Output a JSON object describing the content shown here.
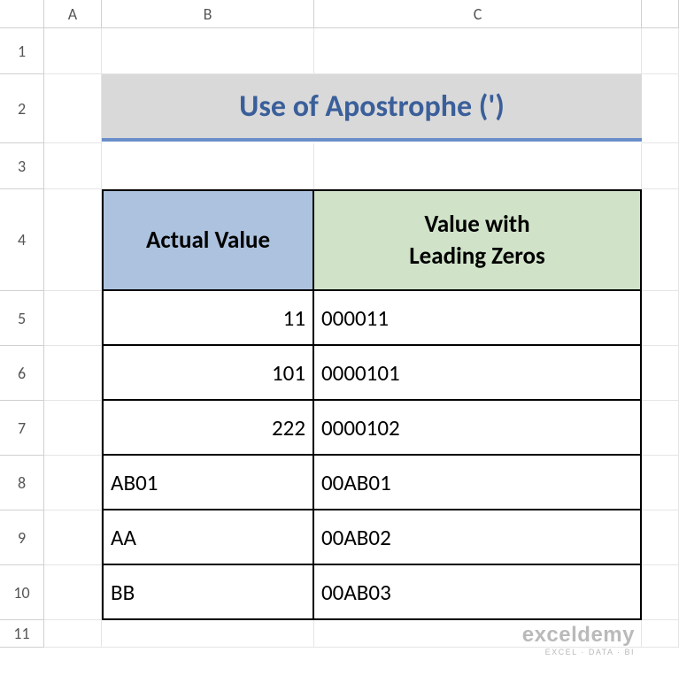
{
  "columns": [
    "A",
    "B",
    "C"
  ],
  "rows": [
    "1",
    "2",
    "3",
    "4",
    "5",
    "6",
    "7",
    "8",
    "9",
    "10",
    "11"
  ],
  "title": "Use of Apostrophe (')",
  "headers": {
    "b": "Actual Value",
    "c": "Value with\nLeading Zeros"
  },
  "chart_data": {
    "type": "table",
    "title": "Use of Apostrophe (')",
    "columns": [
      "Actual Value",
      "Value with Leading Zeros"
    ],
    "rows": [
      {
        "actual": "11",
        "leading": "000011",
        "actual_is_number": true
      },
      {
        "actual": "101",
        "leading": "0000101",
        "actual_is_number": true
      },
      {
        "actual": "222",
        "leading": "0000102",
        "actual_is_number": true
      },
      {
        "actual": "AB01",
        "leading": "00AB01",
        "actual_is_number": false
      },
      {
        "actual": "AA",
        "leading": "00AB02",
        "actual_is_number": false
      },
      {
        "actual": "BB",
        "leading": "00AB03",
        "actual_is_number": false
      }
    ]
  },
  "watermark": {
    "title": "exceldemy",
    "sub": "EXCEL · DATA · BI"
  }
}
